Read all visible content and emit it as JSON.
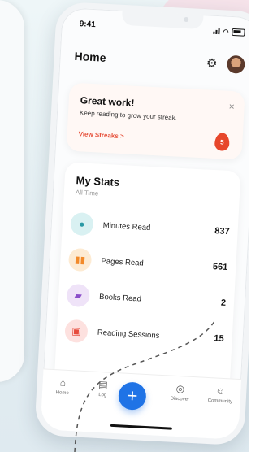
{
  "status": {
    "time": "9:41"
  },
  "header": {
    "title": "Home",
    "settings_icon": "gear-icon"
  },
  "greeting_card": {
    "title": "Great work!",
    "message": "Keep reading to grow your streak.",
    "link": "View Streaks",
    "link_arrow": ">",
    "close_symbol": "×",
    "streak_count": "5"
  },
  "stats": {
    "title": "My Stats",
    "subtitle": "All Time",
    "rows": [
      {
        "label": "Minutes Read",
        "value": "837",
        "icon": "clock-icon",
        "color": "#d9f1f2",
        "icon_color": "#2a9aa5"
      },
      {
        "label": "Pages Read",
        "value": "561",
        "icon": "book-pages-icon",
        "color": "#fdebd3",
        "icon_color": "#f28a2a"
      },
      {
        "label": "Books Read",
        "value": "2",
        "icon": "book-icon",
        "color": "#efe3f8",
        "icon_color": "#8b4fc9"
      },
      {
        "label": "Reading Sessions",
        "value": "15",
        "icon": "calendar-icon",
        "color": "#fde1df",
        "icon_color": "#e64b3c"
      }
    ]
  },
  "tabbar": {
    "items": [
      {
        "label": "Home",
        "icon": "home-icon"
      },
      {
        "label": "Log",
        "icon": "log-icon"
      },
      {
        "label": "Discover",
        "icon": "compass-icon"
      },
      {
        "label": "Community",
        "icon": "people-icon"
      }
    ],
    "fab": "+"
  }
}
